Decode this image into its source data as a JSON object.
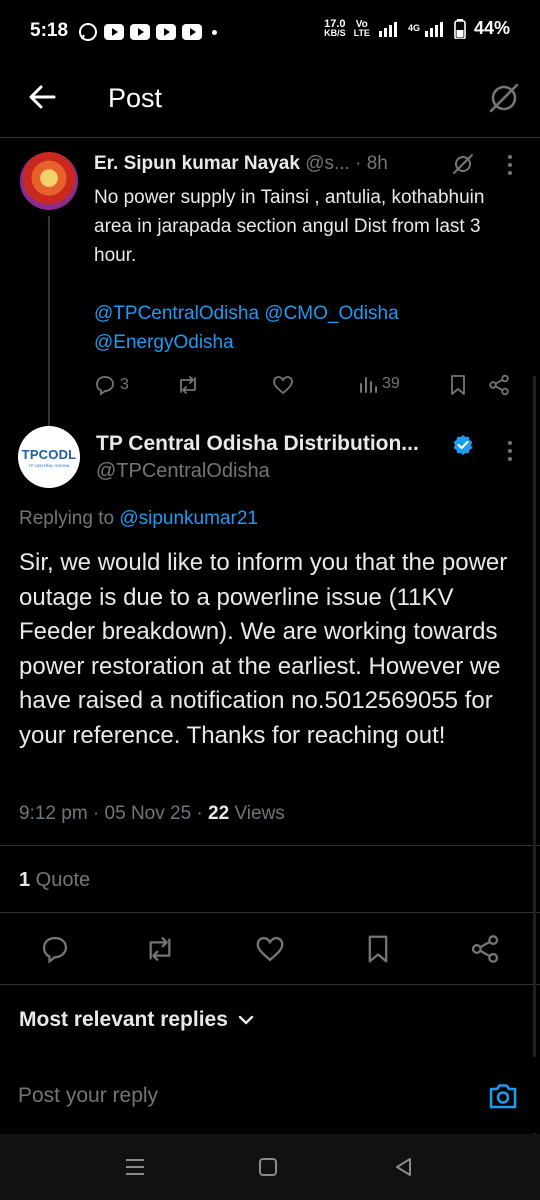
{
  "status_bar": {
    "time": "5:18",
    "net_speed": "17.0",
    "net_unit": "KB/S",
    "vo": "Vo",
    "lte": "LTE",
    "network": "4G",
    "battery": "44%"
  },
  "header": {
    "title": "Post",
    "back_icon": "arrow-left-icon",
    "grok_icon": "grok-icon"
  },
  "quoted_post": {
    "author": "Er. Sipun kumar Nayak",
    "handle": "@s...",
    "time": "· 8h",
    "body": "No power supply in Tainsi , antulia, kothabhuin area in jarapada section angul Dist  from last 3 hour.",
    "mentions": "@TPCentralOdisha @CMO_Odisha @EnergyOdisha",
    "replies": "3",
    "views": "39"
  },
  "main_post": {
    "author": "TP Central Odisha Distribution...",
    "handle": "@TPCentralOdisha",
    "logo_text": "TPCODL",
    "logo_sub": "TP CENTRAL ODISHA",
    "replying_prefix": "Replying to ",
    "replying_handle": "@sipunkumar21",
    "body": "Sir, we would like to inform you that the power outage is due to a powerline issue (11KV Feeder breakdown). We are working towards power restoration at the earliest. However we have raised a notification no.5012569055 for your reference. Thanks for reaching out!",
    "time": "9:12 pm · 05 Nov 25 · ",
    "views_count": "22",
    "views_label": " Views",
    "quote_count": "1",
    "quote_label": " Quote"
  },
  "replies_sort": {
    "label": "Most relevant replies"
  },
  "composer": {
    "placeholder": "Post your reply"
  },
  "colors": {
    "accent": "#1d9bf0",
    "muted": "#71767b",
    "text": "#e7e9ea",
    "background": "#000000"
  }
}
